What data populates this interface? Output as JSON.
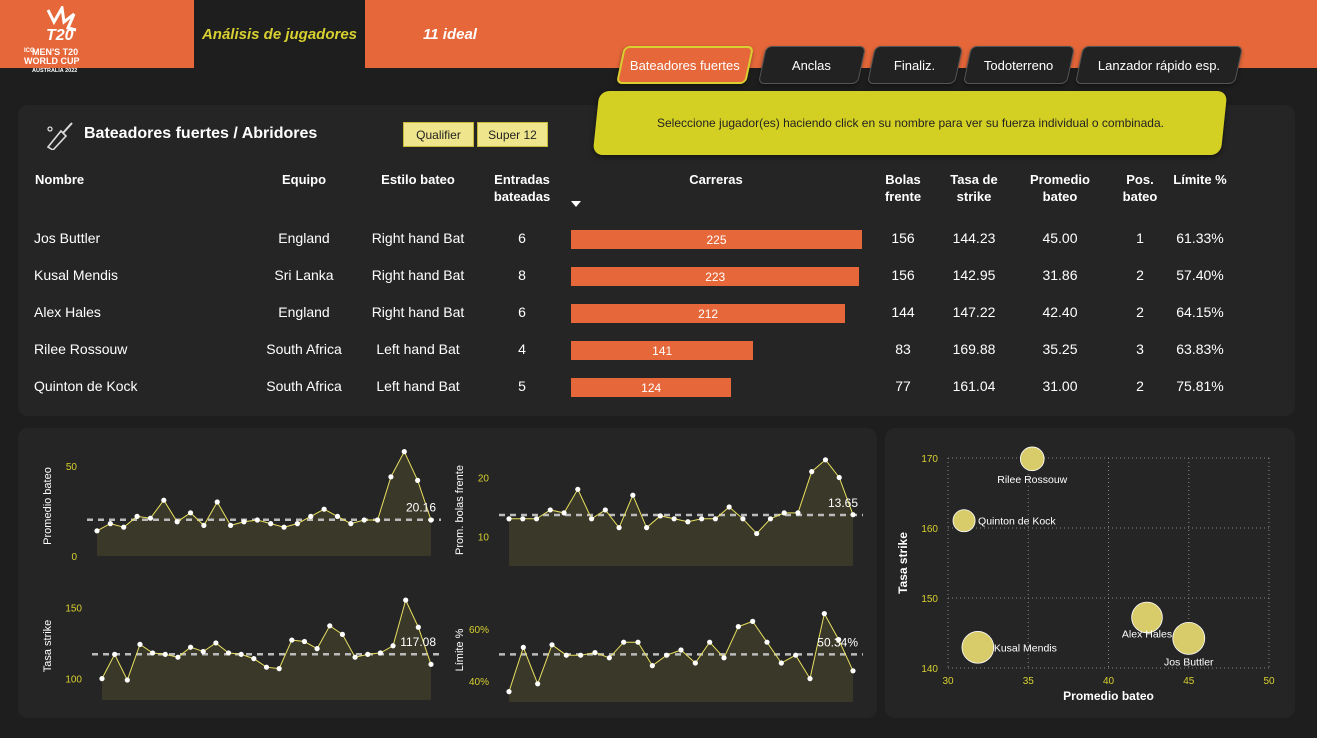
{
  "header": {
    "logo": {
      "line1": "ICC",
      "line2": "MEN'S T20",
      "line3": "WORLD CUP",
      "line4": "AUSTRALIA 2022"
    },
    "tabs": [
      {
        "label": "Análisis de jugadores",
        "active": true
      },
      {
        "label": "11 ideal",
        "active": false
      }
    ],
    "role_buttons": [
      {
        "label": "Bateadores fuertes",
        "active": true
      },
      {
        "label": "Anclas",
        "active": false
      },
      {
        "label": "Finaliz.",
        "active": false
      },
      {
        "label": "Todoterreno",
        "active": false
      },
      {
        "label": "Lanzador rápido esp.",
        "active": false
      }
    ]
  },
  "banner": "Seleccione jugador(es) haciendo click en su nombre para ver su fuerza individual o combinada.",
  "table": {
    "title": "Bateadores fuertes / Abridores",
    "filters": [
      "Qualifier",
      "Super 12"
    ],
    "headers": {
      "name": "Nombre",
      "team": "Equipo",
      "style": "Estilo bateo",
      "innings": [
        "Entradas",
        "bateadas"
      ],
      "runs": "Carreras",
      "balls": [
        "Bolas",
        "frente"
      ],
      "strike": [
        "Tasa de",
        "strike"
      ],
      "avg": [
        "Promedio",
        "bateo"
      ],
      "pos": [
        "Pos.",
        "bateo"
      ],
      "limit": "Límite %"
    },
    "rows": [
      {
        "name": "Jos Buttler",
        "team": "England",
        "style": "Right hand Bat",
        "innings": "6",
        "runs": 225,
        "balls": "156",
        "strike": "144.23",
        "avg": "45.00",
        "pos": "1",
        "limit": "61.33%"
      },
      {
        "name": "Kusal Mendis",
        "team": "Sri Lanka",
        "style": "Right hand Bat",
        "innings": "8",
        "runs": 223,
        "balls": "156",
        "strike": "142.95",
        "avg": "31.86",
        "pos": "2",
        "limit": "57.40%"
      },
      {
        "name": "Alex Hales",
        "team": "England",
        "style": "Right hand Bat",
        "innings": "6",
        "runs": 212,
        "balls": "144",
        "strike": "147.22",
        "avg": "42.40",
        "pos": "2",
        "limit": "64.15%"
      },
      {
        "name": "Rilee Rossouw",
        "team": "South Africa",
        "style": "Left hand Bat",
        "innings": "4",
        "runs": 141,
        "balls": "83",
        "strike": "169.88",
        "avg": "35.25",
        "pos": "3",
        "limit": "63.83%"
      },
      {
        "name": "Quinton de Kock",
        "team": "South Africa",
        "style": "Left hand Bat",
        "innings": "5",
        "runs": 124,
        "balls": "77",
        "strike": "161.04",
        "avg": "31.00",
        "pos": "2",
        "limit": "75.81%"
      }
    ]
  },
  "chart_data": [
    {
      "type": "area",
      "ylabel": "Promedio bateo",
      "yticks": [
        0,
        50
      ],
      "ylim": [
        0,
        60
      ],
      "reference_value": 20.16,
      "reference_label": "20.16",
      "values": [
        14,
        18,
        16,
        22,
        21,
        31,
        19,
        24,
        17,
        30,
        17,
        19,
        20,
        18,
        16,
        18,
        22,
        26,
        22,
        18,
        20,
        20,
        44,
        58,
        42,
        20
      ]
    },
    {
      "type": "area",
      "ylabel": "Prom. bolas frente",
      "yticks": [
        10,
        20
      ],
      "ylim": [
        5,
        25
      ],
      "reference_value": 13.65,
      "reference_label": "13.65",
      "values": [
        13,
        13,
        13,
        14.5,
        14,
        18,
        13,
        14.5,
        11.5,
        17,
        11.5,
        13.5,
        13,
        12.5,
        13,
        13,
        15,
        13,
        10.5,
        13,
        14,
        14,
        21,
        23,
        20,
        13.7
      ]
    },
    {
      "type": "area",
      "ylabel": "Tasa strike",
      "yticks": [
        100,
        150
      ],
      "ylim": [
        85,
        160
      ],
      "reference_value": 117.08,
      "reference_label": "117.08",
      "values": [
        100,
        117,
        99,
        124,
        118,
        117,
        115,
        122,
        119,
        125,
        118,
        117,
        114,
        108,
        107,
        127,
        126,
        121,
        137,
        131,
        115,
        117,
        118,
        123,
        155,
        136,
        110
      ]
    },
    {
      "type": "area",
      "ylabel": "Límite %",
      "yticks": [
        "40%",
        "60%"
      ],
      "ylim": [
        32,
        72
      ],
      "reference_value": 50.34,
      "reference_label": "50.34%",
      "values": [
        36,
        53,
        39,
        54,
        50,
        50,
        51,
        49,
        55,
        55,
        46,
        50,
        52,
        47,
        55,
        49,
        61,
        63,
        55,
        47,
        50,
        41,
        66,
        56,
        44
      ]
    },
    {
      "type": "scatter",
      "xlabel": "Promedio bateo",
      "ylabel": "Tasa strike",
      "xlim": [
        30,
        50
      ],
      "ylim": [
        140,
        170
      ],
      "xticks": [
        30,
        35,
        40,
        45,
        50
      ],
      "yticks": [
        140,
        150,
        160,
        170
      ],
      "grid": true,
      "points": [
        {
          "label": "Rilee Rossouw",
          "x": 35.25,
          "y": 169.88,
          "size": 141
        },
        {
          "label": "Quinton de Kock",
          "x": 31.0,
          "y": 161.04,
          "size": 124
        },
        {
          "label": "Alex Hales",
          "x": 42.4,
          "y": 147.22,
          "size": 212
        },
        {
          "label": "Kusal Mendis",
          "x": 31.86,
          "y": 142.95,
          "size": 223
        },
        {
          "label": "Jos Buttler",
          "x": 45.0,
          "y": 144.23,
          "size": 225
        }
      ]
    }
  ],
  "colors": {
    "accent": "#e6683a",
    "highlight": "#d8d030",
    "background": "#1e1e1e",
    "panel": "#252525",
    "area_fill": "#3a3829",
    "point": "#d8cc6a"
  }
}
